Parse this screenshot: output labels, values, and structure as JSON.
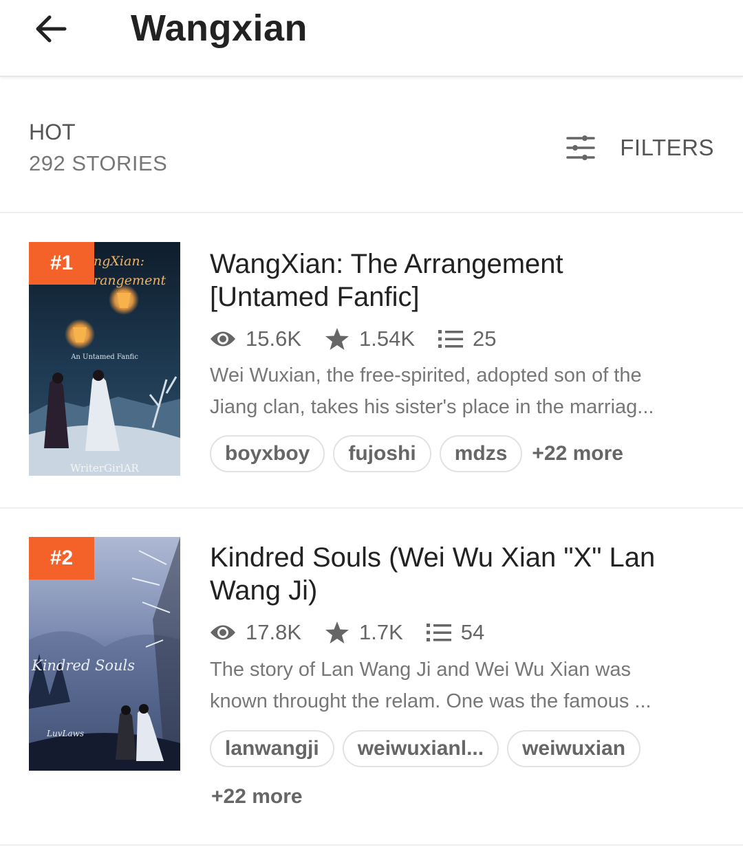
{
  "header": {
    "title": "Wangxian"
  },
  "list_header": {
    "sort": "HOT",
    "count": "292 STORIES",
    "filters_label": "FILTERS"
  },
  "stories": [
    {
      "rank": "#1",
      "title_line1": "WangXian: The Arrangement",
      "title_line2": "[Untamed Fanfic]",
      "reads": "15.6K",
      "votes": "1.54K",
      "parts": "25",
      "desc_line1": "Wei Wuxian, the free-spirited, adopted son of the",
      "desc_line2": "Jiang clan, takes his sister's place in the marriag...",
      "tags": [
        "boyxboy",
        "fujoshi",
        "mdzs"
      ],
      "more": "+22 more",
      "cover": {
        "title_fragment_1": "ngXian:",
        "title_fragment_2": "rangement",
        "subtitle": "An Untamed Fanfic",
        "author": "WriterGirlAR"
      }
    },
    {
      "rank": "#2",
      "title_line1": "Kindred Souls (Wei Wu Xian \"X\" Lan",
      "title_line2": "Wang Ji)",
      "reads": "17.8K",
      "votes": "1.7K",
      "parts": "54",
      "desc_line1": "The story of Lan Wang Ji and Wei Wu Xian was",
      "desc_line2": "known throught the relam. One was the famous ...",
      "tags": [
        "lanwangji",
        "weiwuxianl...",
        "weiwuxian"
      ],
      "more": "+22 more",
      "cover": {
        "title": "Kindred Souls",
        "author": "LuvLaws"
      }
    }
  ],
  "colors": {
    "accent": "#f4622a",
    "text_primary": "#222222",
    "text_secondary": "#777777",
    "divider": "#efefef"
  },
  "icons": {
    "back": "arrow-left-icon",
    "filters": "sliders-icon",
    "reads": "eye-icon",
    "votes": "star-icon",
    "parts": "list-icon"
  }
}
